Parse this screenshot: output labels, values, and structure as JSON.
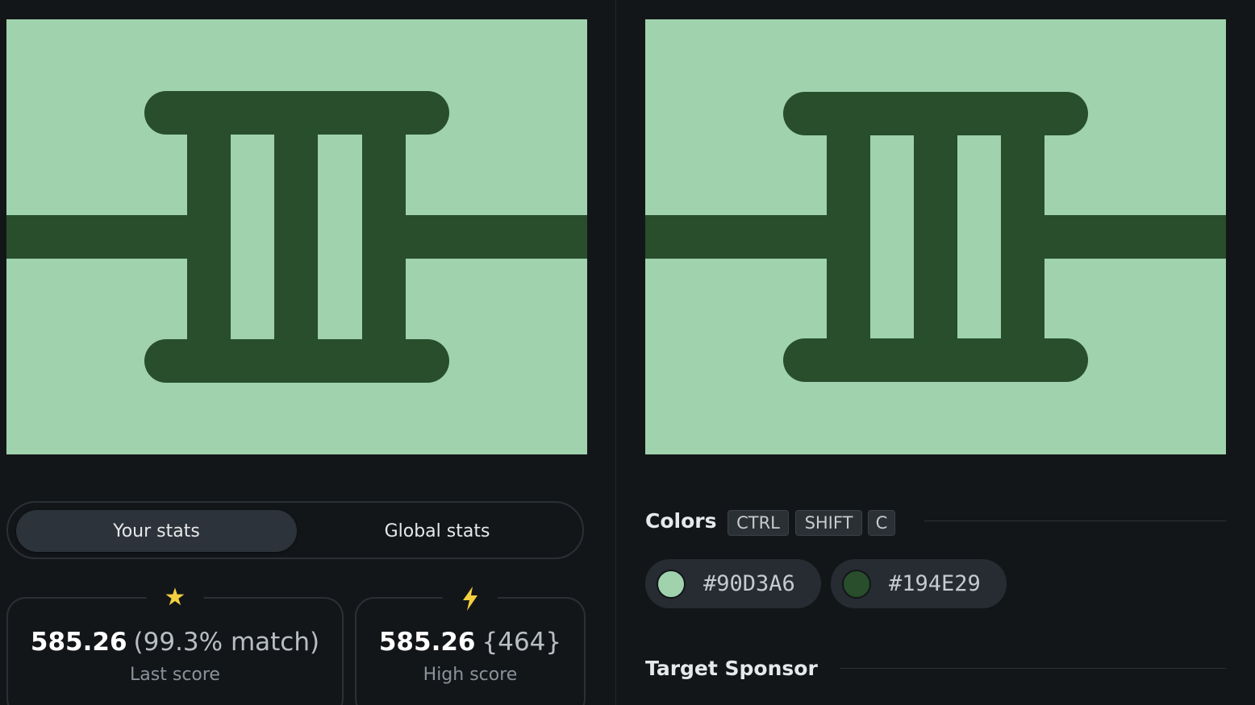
{
  "stats_tabs": {
    "your_stats": "Your stats",
    "global_stats": "Global stats",
    "active": "your_stats"
  },
  "last_score": {
    "icon": "star-icon",
    "value": "585.26",
    "detail": "(99.3% match)",
    "label": "Last score"
  },
  "high_score": {
    "icon": "lightning-icon",
    "value": "585.26",
    "detail": "{464}",
    "label": "High score"
  },
  "colors": {
    "title": "Colors",
    "shortcut": [
      "CTRL",
      "SHIFT",
      "C"
    ],
    "swatches": [
      {
        "hex": "#90D3A6",
        "color": "#9fd2ad"
      },
      {
        "hex": "#194E29",
        "color": "#284e2c"
      }
    ]
  },
  "target_sponsor": {
    "title": "Target Sponsor"
  },
  "palette": {
    "background": "#131619",
    "canvas_light": "#9fd2ad",
    "canvas_dark": "#284e2c",
    "accent_star": "#f4d03f"
  }
}
